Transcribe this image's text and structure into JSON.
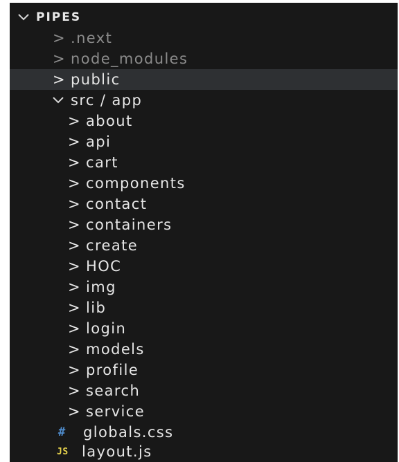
{
  "explorer": {
    "root": {
      "label": "PIPES",
      "expanded": true,
      "twisty": "chevron-down"
    },
    "items": [
      {
        "label": ".next",
        "type": "folder",
        "expanded": false,
        "twisty": ">"
      },
      {
        "label": "node_modules",
        "type": "folder",
        "expanded": false,
        "twisty": ">"
      },
      {
        "label": "public",
        "type": "folder",
        "expanded": false,
        "selected": true,
        "twisty": ">"
      },
      {
        "label": "src / app",
        "type": "folder",
        "expanded": true,
        "twisty": "chevron-down"
      }
    ],
    "app_items": [
      {
        "label": "about",
        "twisty": ">"
      },
      {
        "label": "api",
        "twisty": ">"
      },
      {
        "label": "cart",
        "twisty": ">"
      },
      {
        "label": "components",
        "twisty": ">"
      },
      {
        "label": "contact",
        "twisty": ">"
      },
      {
        "label": "containers",
        "twisty": ">"
      },
      {
        "label": "create",
        "twisty": ">"
      },
      {
        "label": "HOC",
        "twisty": ">"
      },
      {
        "label": "img",
        "twisty": ">"
      },
      {
        "label": "lib",
        "twisty": ">"
      },
      {
        "label": "login",
        "twisty": ">"
      },
      {
        "label": "models",
        "twisty": ">"
      },
      {
        "label": "profile",
        "twisty": ">"
      },
      {
        "label": "search",
        "twisty": ">"
      },
      {
        "label": "service",
        "twisty": ">"
      }
    ],
    "files": [
      {
        "label": "globals.css",
        "icon": "#",
        "icon_name": "css-file-icon"
      },
      {
        "label": "layout.js",
        "icon": "JS",
        "icon_name": "js-file-icon"
      }
    ]
  },
  "colors": {
    "background": "#181818",
    "selected_row": "#2e3033",
    "text": "#e6e6e6",
    "dim_text": "#8b8b8b",
    "css_icon": "#4f8ccc",
    "js_icon": "#e8d44d"
  }
}
